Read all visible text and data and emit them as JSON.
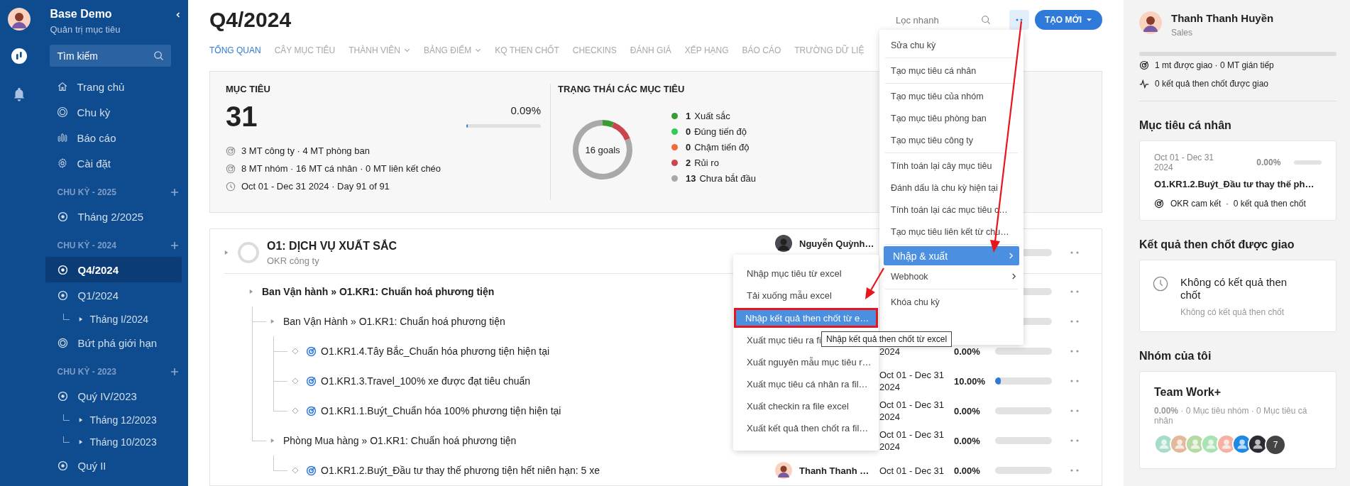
{
  "sidebar": {
    "brand": "Base Demo",
    "subtitle": "Quản trị mục tiêu",
    "search": {
      "placeholder": "Tìm kiếm"
    },
    "nav": [
      {
        "label": "Trang chủ",
        "kind": "home"
      },
      {
        "label": "Chu kỳ",
        "kind": "cycle"
      },
      {
        "label": "Báo cáo",
        "kind": "report"
      },
      {
        "label": "Cài đặt",
        "kind": "settings"
      }
    ],
    "sections": [
      {
        "title": "CHU KỲ - 2025",
        "items": [
          {
            "label": "Tháng 2/2025",
            "kind": "dot",
            "selected": false
          }
        ]
      },
      {
        "title": "CHU KỲ - 2024",
        "items": [
          {
            "label": "Q4/2024",
            "kind": "dot",
            "selected": true
          },
          {
            "label": "Q1/2024",
            "kind": "dot",
            "selected": false,
            "children": [
              {
                "label": "Tháng I/2024",
                "selected": false
              }
            ]
          },
          {
            "label": "Bứt phá giới hạn",
            "kind": "ring",
            "selected": false
          }
        ]
      },
      {
        "title": "CHU KỲ - 2023",
        "items": [
          {
            "label": "Quý IV/2023",
            "kind": "dot",
            "selected": false,
            "children": [
              {
                "label": "Tháng 12/2023",
                "selected": false
              },
              {
                "label": "Tháng 10/2023",
                "selected": false
              }
            ]
          },
          {
            "label": "Quý II",
            "kind": "dot",
            "selected": false
          }
        ]
      }
    ]
  },
  "header": {
    "title": "Q4/2024",
    "filter": {
      "placeholder": "Lọc nhanh"
    },
    "create_button": "TẠO MỚI"
  },
  "tabs": [
    {
      "label": "TỔNG QUAN",
      "selected": true,
      "dropdown": false
    },
    {
      "label": "CÂY MỤC TIÊU",
      "selected": false,
      "dropdown": false
    },
    {
      "label": "THÀNH VIÊN",
      "selected": false,
      "dropdown": true
    },
    {
      "label": "BẢNG ĐIỂM",
      "selected": false,
      "dropdown": true
    },
    {
      "label": "KQ THEN CHỐT",
      "selected": false,
      "dropdown": false
    },
    {
      "label": "CHECKINS",
      "selected": false,
      "dropdown": false
    },
    {
      "label": "ĐÁNH GIÁ",
      "selected": false,
      "dropdown": false
    },
    {
      "label": "XẾP HẠNG",
      "selected": false,
      "dropdown": false
    },
    {
      "label": "BÁO CÁO",
      "selected": false,
      "dropdown": false
    },
    {
      "label": "TRƯỜNG DỮ LIỆ",
      "selected": false,
      "dropdown": false
    }
  ],
  "summary": {
    "title": "MỤC TIÊU",
    "count": "31",
    "percent": "0.09%",
    "level": 0.0009,
    "stats": [
      {
        "kind": "target",
        "text": "3 MT công ty · 4 MT phòng ban"
      },
      {
        "kind": "target",
        "text": "8 MT nhóm · 16 MT cá nhân · 0 MT liên kết chéo"
      },
      {
        "kind": "clock",
        "text": "Oct 01 - Dec 31 2024 · Day 91 of 91"
      }
    ]
  },
  "status": {
    "title": "TRẠNG THÁI CÁC MỤC TIÊU",
    "center_label": "16 goals",
    "legend": [
      {
        "count": "1",
        "color": "#3a9b35"
      },
      {
        "count": "0",
        "color": "#2ecc52"
      },
      {
        "count": "0",
        "color": "#f06a3c"
      },
      {
        "count": "2",
        "color": "#c9464e"
      },
      {
        "count": "13",
        "color": "#a9a9a9"
      }
    ],
    "chart_data": {
      "type": "donut",
      "categories": [
        "Xuất sắc",
        "Đúng tiến độ",
        "Chậm tiến độ",
        "Rủi ro",
        "Chưa bắt đầu"
      ],
      "values": [
        6.25,
        0,
        0,
        12.5,
        81.25
      ]
    }
  },
  "goals": [
    {
      "kind": "objective",
      "title": "O1: DỊCH VỤ XUẤT SẮC",
      "subtitle": "OKR công ty",
      "owner": {
        "name": "Nguyễn Quỳnh…",
        "kind": "photo"
      },
      "level": 0,
      "children": [
        {
          "kind": "group",
          "title": "Ban Vận hành » O1.KR1: Chuẩn hoá phương tiện",
          "level": 0,
          "children": [
            {
              "kind": "group",
              "title": "Ban Vận Hành » O1.KR1: Chuẩn hoá phương tiện",
              "level": 0,
              "children": [
                {
                  "kind": "kr",
                  "title": "O1.KR1.4.Tây Bắc_Chuẩn hóa phương tiện hiện tại",
                  "date": "2024",
                  "percent": "0.00%",
                  "level": 0
                },
                {
                  "kind": "kr",
                  "title": "O1.KR1.3.Travel_100% xe được đạt tiêu chuẩn",
                  "date": "Oct 01 - Dec 31 2024",
                  "percent": "10.00%",
                  "level": 0.1
                },
                {
                  "kind": "kr",
                  "title": "O1.KR1.1.Buýt_Chuẩn hóa 100% phương tiện hiện tại",
                  "date": "Oct 01 - Dec 31 2024",
                  "percent": "0.00%",
                  "level": 0
                }
              ]
            },
            {
              "kind": "group",
              "title": "Phòng Mua hàng » O1.KR1: Chuẩn hoá phương tiện",
              "date": "Oct 01 - Dec 31 2024",
              "percent": "0.00%",
              "level": 0,
              "children": [
                {
                  "kind": "kr",
                  "title": "O1.KR1.2.Buýt_Đầu tư thay thế phương tiện hết niên hạn: 5 xe",
                  "owner": {
                    "name": "Thanh Thanh …",
                    "kind": "cartoon"
                  },
                  "date": "Oct 01 - Dec 31",
                  "percent": "0.00%",
                  "level": 0
                }
              ]
            }
          ]
        }
      ]
    }
  ],
  "menu": {
    "groups": [
      [
        {
          "label": "Sửa chu kỳ",
          "selected": false,
          "submenu": false
        }
      ],
      [
        {
          "label": "Tạo mục tiêu cá nhân",
          "selected": false,
          "submenu": false
        }
      ],
      [
        {
          "label": "Tạo mục tiêu của nhóm",
          "selected": false,
          "submenu": false
        },
        {
          "label": "Tạo mục tiêu phòng ban",
          "selected": false,
          "submenu": false
        },
        {
          "label": "Tạo mục tiêu công ty",
          "selected": false,
          "submenu": false
        }
      ],
      [
        {
          "label": "Tính toán lại cây mục tiêu",
          "selected": false,
          "submenu": false
        },
        {
          "label": "Đánh dấu là chu kỳ hiện tại",
          "selected": false,
          "submenu": false
        },
        {
          "label": "Tính toán lại các mục tiêu c…",
          "selected": false,
          "submenu": false
        },
        {
          "label": "Tạo mục tiêu liên kết từ chu…",
          "selected": false,
          "submenu": false
        }
      ],
      [
        {
          "label": "Nhập & xuất",
          "selected": true,
          "submenu": true
        },
        {
          "label": "Webhook",
          "selected": false,
          "submenu": true
        }
      ],
      [
        {
          "label": "Khóa chu kỳ",
          "selected": false,
          "submenu": false
        }
      ]
    ]
  },
  "submenu": {
    "groups": [
      [
        {
          "label": "Nhập mục tiêu từ excel",
          "selected": false,
          "callout": false
        },
        {
          "label": "Tải xuống mẫu excel",
          "selected": false,
          "callout": false
        }
      ],
      [
        {
          "label": "Nhập kết quả then chốt từ e…",
          "selected": true,
          "callout": true
        }
      ],
      [
        {
          "label": "Xuất mục tiêu ra fi",
          "selected": false,
          "callout": false
        },
        {
          "label": "Xuất nguyên mẫu mục tiêu r…",
          "selected": false,
          "callout": false
        },
        {
          "label": "Xuất mục tiêu cá nhân ra fil…",
          "selected": false,
          "callout": false
        },
        {
          "label": "Xuất checkin ra file excel",
          "selected": false,
          "callout": false
        },
        {
          "label": "Xuất kết quả then chốt ra fil…",
          "selected": false,
          "callout": false
        }
      ]
    ]
  },
  "tooltip": {
    "text": "Nhập kết quả then chốt từ excel"
  },
  "profile": {
    "name": "Thanh Thanh Huyền",
    "role": "Sales",
    "level": 0,
    "stats": [
      {
        "kind": "target",
        "text": "1 mt được giao · 0 MT gián tiếp"
      },
      {
        "kind": "pulse",
        "text": "0 kết quả then chốt được giao"
      }
    ]
  },
  "personal": {
    "heading": "Mục tiêu cá nhân",
    "date": "Oct 01 - Dec 31 2024",
    "percent": "0.00%",
    "level": 0,
    "title": "O1.KR1.2.Buýt_Đầu tư thay thế ph…",
    "meta": "OKR cam kết  ·  0 kết quả then chốt"
  },
  "assigned": {
    "heading": "Kết quả then chốt được giao",
    "empty_title": "Không có kết quả then chốt",
    "empty_text": "Không có kết quả then chốt"
  },
  "teams": {
    "heading": "Nhóm của tôi",
    "items": [
      {
        "name": "Team Work+",
        "summary": "**0.00%** · 0 Mục tiêu nhóm · 0 Mục tiêu cá nhân",
        "members": [
          {
            "color": "#a7dcc9"
          },
          {
            "color": "#e3b99c"
          },
          {
            "color": "#b7d9a3"
          },
          {
            "color": "#a9e2b3"
          },
          {
            "color": "#f5b2a2"
          },
          {
            "color": "#1e88e5"
          },
          {
            "color": "#2b2b33"
          }
        ],
        "more": "7"
      }
    ]
  }
}
